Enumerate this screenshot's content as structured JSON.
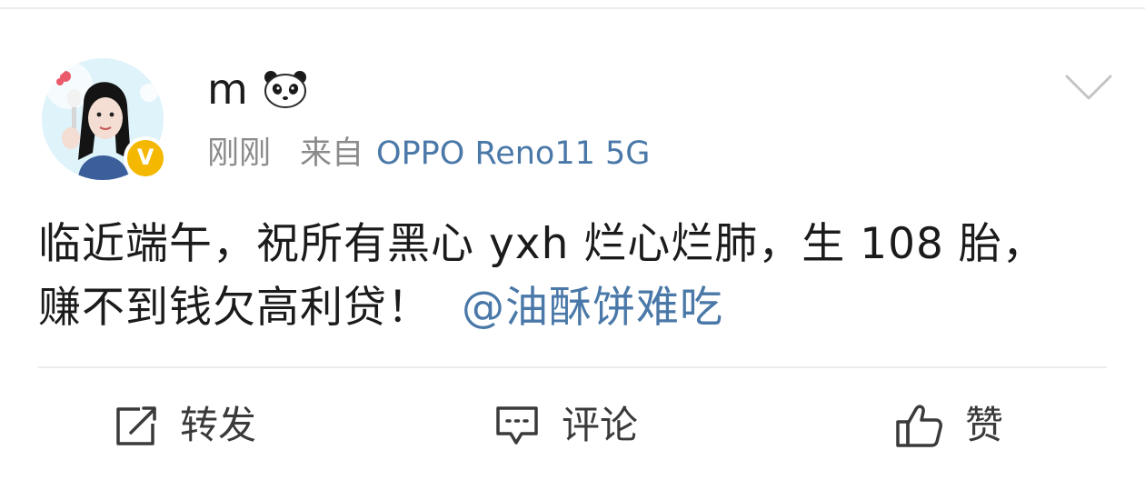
{
  "post": {
    "username": "m",
    "time": "刚刚",
    "source_prefix": "来自",
    "device": "OPPO Reno11 5G",
    "text_line1": "临近端午，祝所有黑心 yxh 烂心烂肺，生 108 胎，",
    "text_line2": "赚不到钱欠高利贷！",
    "mention": "@油酥饼难吃",
    "verified_mark": "V"
  },
  "actions": {
    "repost_label": "转发",
    "comment_label": "评论",
    "like_label": "赞"
  },
  "colors": {
    "link": "#4a78a8",
    "meta": "#8b8b8b",
    "text": "#1b1b1b",
    "badge": "#f5b800"
  },
  "icons": {
    "more": "chevron-down-icon",
    "repost": "repost-icon",
    "comment": "comment-icon",
    "like": "thumbs-up-icon",
    "emoji": "panda-icon"
  }
}
